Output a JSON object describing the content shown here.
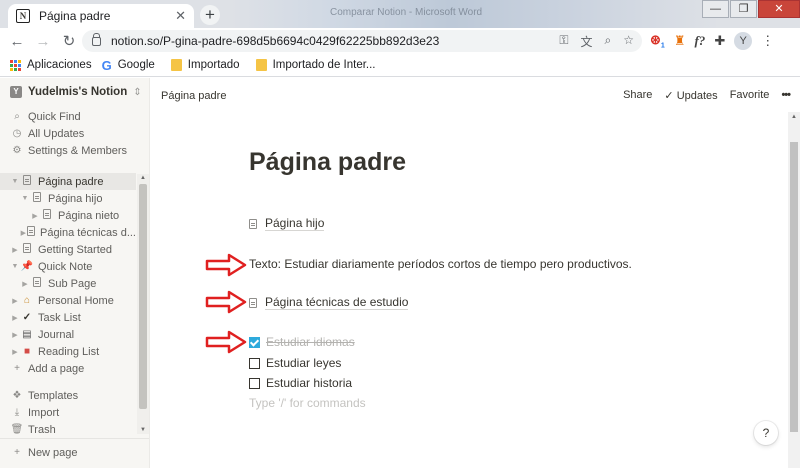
{
  "browser": {
    "tab_title": "Página padre",
    "tab_close": "✕",
    "new_tab": "+",
    "background_title": "Comparar Notion - Microsoft Word",
    "url": "notion.so/P-gina-padre-698d5b6694c0429f62225bb892d3e23",
    "window_controls": [
      "—",
      "❐",
      "✕"
    ],
    "profile_initial": "Y",
    "ext_badge": "1",
    "ext_f": "f?"
  },
  "bookmarks": [
    {
      "label": "Aplicaciones",
      "icon": "apps-grid-icon"
    },
    {
      "label": "Google",
      "icon": "google-icon"
    },
    {
      "label": "Importado",
      "icon": "folder-icon"
    },
    {
      "label": "Importado de Inter...",
      "icon": "folder-icon"
    }
  ],
  "sidebar": {
    "workspace": "Yudelmis's Notion",
    "workspace_badge": "Y",
    "top_items": [
      "Quick Find",
      "All Updates",
      "Settings & Members"
    ],
    "tree": [
      {
        "label": "Página padre",
        "level": 0,
        "icon": "page",
        "active": true
      },
      {
        "label": "Página hijo",
        "level": 1,
        "icon": "page"
      },
      {
        "label": "Página nieto",
        "level": 2,
        "icon": "page"
      },
      {
        "label": "Página técnicas d...",
        "level": 1,
        "icon": "page"
      },
      {
        "label": "Getting Started",
        "level": 0,
        "icon": "page"
      },
      {
        "label": "Quick Note",
        "level": 0,
        "icon": "pin"
      },
      {
        "label": "Sub Page",
        "level": 1,
        "icon": "page"
      },
      {
        "label": "Personal Home",
        "level": 0,
        "icon": "house"
      },
      {
        "label": "Task List",
        "level": 0,
        "icon": "check"
      },
      {
        "label": "Journal",
        "level": 0,
        "icon": "journal"
      },
      {
        "label": "Reading List",
        "level": 0,
        "icon": "book"
      }
    ],
    "add_page": "Add a page",
    "bottom_items": [
      "Templates",
      "Import",
      "Trash"
    ],
    "new_page": "New page"
  },
  "topbar": {
    "breadcrumb": "Página padre",
    "share": "Share",
    "updates": "Updates",
    "favorite": "Favorite",
    "more": "•••"
  },
  "page": {
    "title": "Página padre",
    "sub_page_1": "Página hijo",
    "text_block": "Texto: Estudiar diariamente períodos cortos de tiempo pero productivos.",
    "sub_page_2": "Página técnicas de estudio",
    "todos": [
      {
        "label": "Estudiar idiomas",
        "checked": true
      },
      {
        "label": "Estudiar leyes",
        "checked": false
      },
      {
        "label": "Estudiar historia",
        "checked": false
      }
    ],
    "placeholder": "Type '/' for commands",
    "help": "?"
  },
  "colors": {
    "annotation_arrow": "#e02020",
    "checkbox_checked": "#2eaadc",
    "sidebar_bg": "#f7f6f3"
  }
}
